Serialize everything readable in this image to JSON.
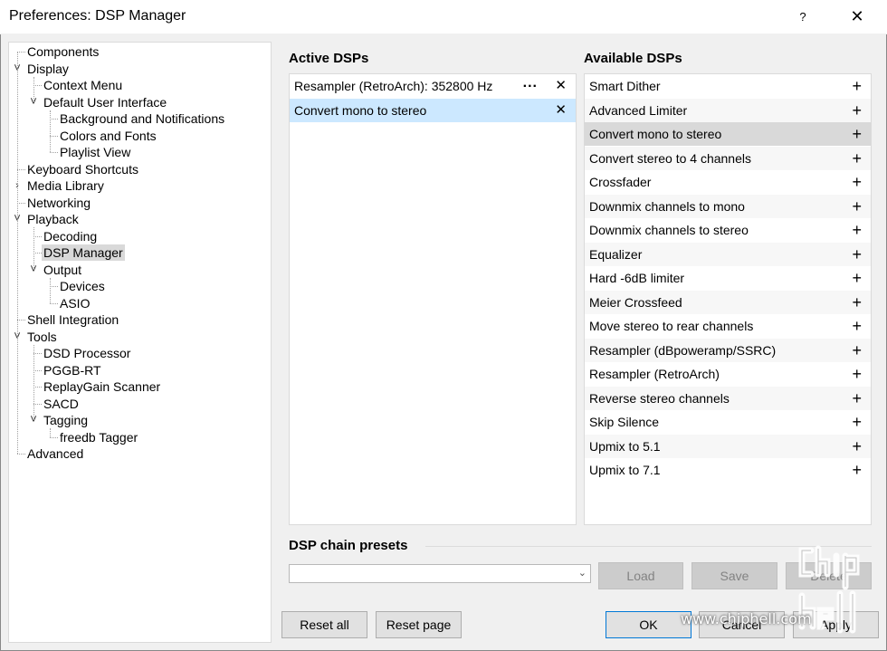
{
  "window": {
    "title": "Preferences: DSP Manager",
    "help": "?",
    "close": "✕"
  },
  "tree": [
    {
      "label": "Components",
      "level": 0
    },
    {
      "label": "Display",
      "level": 0,
      "expander": "open"
    },
    {
      "label": "Context Menu",
      "level": 1
    },
    {
      "label": "Default User Interface",
      "level": 1,
      "expander": "open"
    },
    {
      "label": "Background and Notifications",
      "level": 2
    },
    {
      "label": "Colors and Fonts",
      "level": 2
    },
    {
      "label": "Playlist View",
      "level": 2
    },
    {
      "label": "Keyboard Shortcuts",
      "level": 0
    },
    {
      "label": "Media Library",
      "level": 0,
      "expander": "closed"
    },
    {
      "label": "Networking",
      "level": 0
    },
    {
      "label": "Playback",
      "level": 0,
      "expander": "open"
    },
    {
      "label": "Decoding",
      "level": 1
    },
    {
      "label": "DSP Manager",
      "level": 1,
      "selected": true
    },
    {
      "label": "Output",
      "level": 1,
      "expander": "open"
    },
    {
      "label": "Devices",
      "level": 2
    },
    {
      "label": "ASIO",
      "level": 2
    },
    {
      "label": "Shell Integration",
      "level": 0
    },
    {
      "label": "Tools",
      "level": 0,
      "expander": "open"
    },
    {
      "label": "DSD Processor",
      "level": 1
    },
    {
      "label": "PGGB-RT",
      "level": 1
    },
    {
      "label": "ReplayGain Scanner",
      "level": 1
    },
    {
      "label": "SACD",
      "level": 1
    },
    {
      "label": "Tagging",
      "level": 1,
      "expander": "open"
    },
    {
      "label": "freedb Tagger",
      "level": 2
    },
    {
      "label": "Advanced",
      "level": 0
    }
  ],
  "active": {
    "header": "Active DSPs",
    "items": [
      {
        "label": "Resampler (RetroArch): 352800 Hz",
        "configurable": true
      },
      {
        "label": "Convert mono to stereo",
        "selected": true
      }
    ],
    "more": "...",
    "remove": "✕"
  },
  "available": {
    "header": "Available DSPs",
    "add": "+",
    "items": [
      "Smart Dither",
      "Advanced Limiter",
      "Convert mono to stereo",
      "Convert stereo to 4 channels",
      "Crossfader",
      "Downmix channels to mono",
      "Downmix channels to stereo",
      "Equalizer",
      "Hard -6dB limiter",
      "Meier Crossfeed",
      "Move stereo to rear channels",
      "Resampler (dBpoweramp/SSRC)",
      "Resampler (RetroArch)",
      "Reverse stereo channels",
      "Skip Silence",
      "Upmix to 5.1",
      "Upmix to 7.1"
    ],
    "highlighted_index": 2
  },
  "presets": {
    "header": "DSP chain presets",
    "combo_value": "",
    "load": "Load",
    "save": "Save",
    "delete": "Delete"
  },
  "footer": {
    "reset_all": "Reset all",
    "reset_page": "Reset page",
    "ok": "OK",
    "cancel": "Cancel",
    "apply": "Apply"
  },
  "watermark": {
    "text": "www.chiphell.com",
    "logo": "chip hell"
  },
  "colors": {
    "selection": "#cce8ff",
    "hover": "#d9d9d9",
    "focus_border": "#0078d7"
  }
}
